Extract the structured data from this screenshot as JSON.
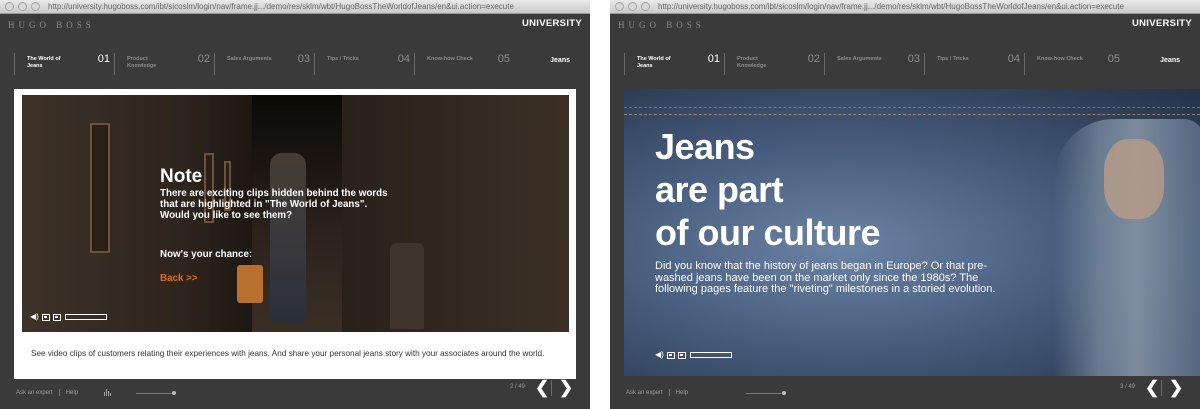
{
  "windows": [
    {
      "url": "http://university.hugoboss.com/ibt/sicoslm/login/nav/frame.jj.../demo/res/sklm/wbt/HugoBossTheWorldofJeans/en&ui.action=execute",
      "brand": "HUGO BOSS",
      "university": "UNIVERSITY",
      "nav": [
        {
          "label": "The World of Jeans",
          "num": "01",
          "active": true
        },
        {
          "label": "Product Knowledge",
          "num": "02",
          "active": false
        },
        {
          "label": "Sales Arguments",
          "num": "03",
          "active": false
        },
        {
          "label": "Tips / Tricks",
          "num": "04",
          "active": false
        },
        {
          "label": "Know-how Check",
          "num": "05",
          "active": false
        }
      ],
      "nav_end": "Jeans",
      "note": {
        "title": "Note",
        "text": "There are exciting clips hidden behind the words that are highlighted in \"The World of Jeans\". Would you like to see them?",
        "chance": "Now's your chance:",
        "back": "Back >>"
      },
      "caption": "See video clips of customers relating their experiences with jeans. And share your personal jeans story with your associates around the world.",
      "footer": {
        "ask": "Ask an expert",
        "help": "Help"
      },
      "page": "2 / 49",
      "prev": "❮",
      "next": "❯"
    },
    {
      "url": "http://university.hugoboss.com/ibt/sicoslm/login/nav/frame.jj.../demo/res/sklm/wbt/HugoBossTheWorldofJeans/en&ui.action=execute",
      "brand": "HUGO BOSS",
      "university": "UNIVERSITY",
      "nav": [
        {
          "label": "The World of Jeans",
          "num": "01",
          "active": true
        },
        {
          "label": "Product Knowledge",
          "num": "02",
          "active": false
        },
        {
          "label": "Sales Arguments",
          "num": "03",
          "active": false
        },
        {
          "label": "Tips / Tricks",
          "num": "04",
          "active": false
        },
        {
          "label": "Know-how Check",
          "num": "05",
          "active": false
        }
      ],
      "nav_end": "Jeans",
      "headline": [
        "Jeans",
        "are part",
        "of our culture"
      ],
      "body": "Did you know that the history of jeans began in Europe? Or that pre-washed jeans have been on the market only since the 1980s? The following pages feature the \"riveting\" milestones in a storied evolution.",
      "footer": {
        "ask": "Ask an expert",
        "help": "Help"
      },
      "page": "3 / 49",
      "prev": "❮",
      "next": "❯"
    }
  ]
}
